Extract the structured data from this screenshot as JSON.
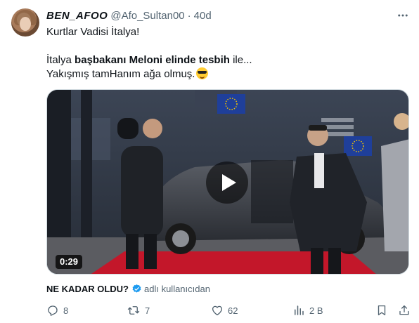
{
  "author": {
    "display_name": "BEN_AFOO",
    "handle": "@Afo_Sultan00",
    "separator": "·",
    "time": "40d"
  },
  "tweet": {
    "line1": "Kurtlar Vadisi İtalya!",
    "line2_pre": "İtalya ",
    "line2_bold": "başbakanı Meloni elinde tesbih",
    "line2_post": " ile...",
    "line3": "Yakışmış tamHanım ağa olmuş."
  },
  "video": {
    "duration": "0:29"
  },
  "source": {
    "title": "NE KADAR OLDU?",
    "by": "adlı kullanıcıdan"
  },
  "actions": {
    "replies": "8",
    "reposts": "7",
    "likes": "62",
    "views": "2 B"
  },
  "colors": {
    "text": "#0f1419",
    "secondary": "#536471",
    "verified": "#1d9bf0",
    "border": "#cfd9de"
  }
}
